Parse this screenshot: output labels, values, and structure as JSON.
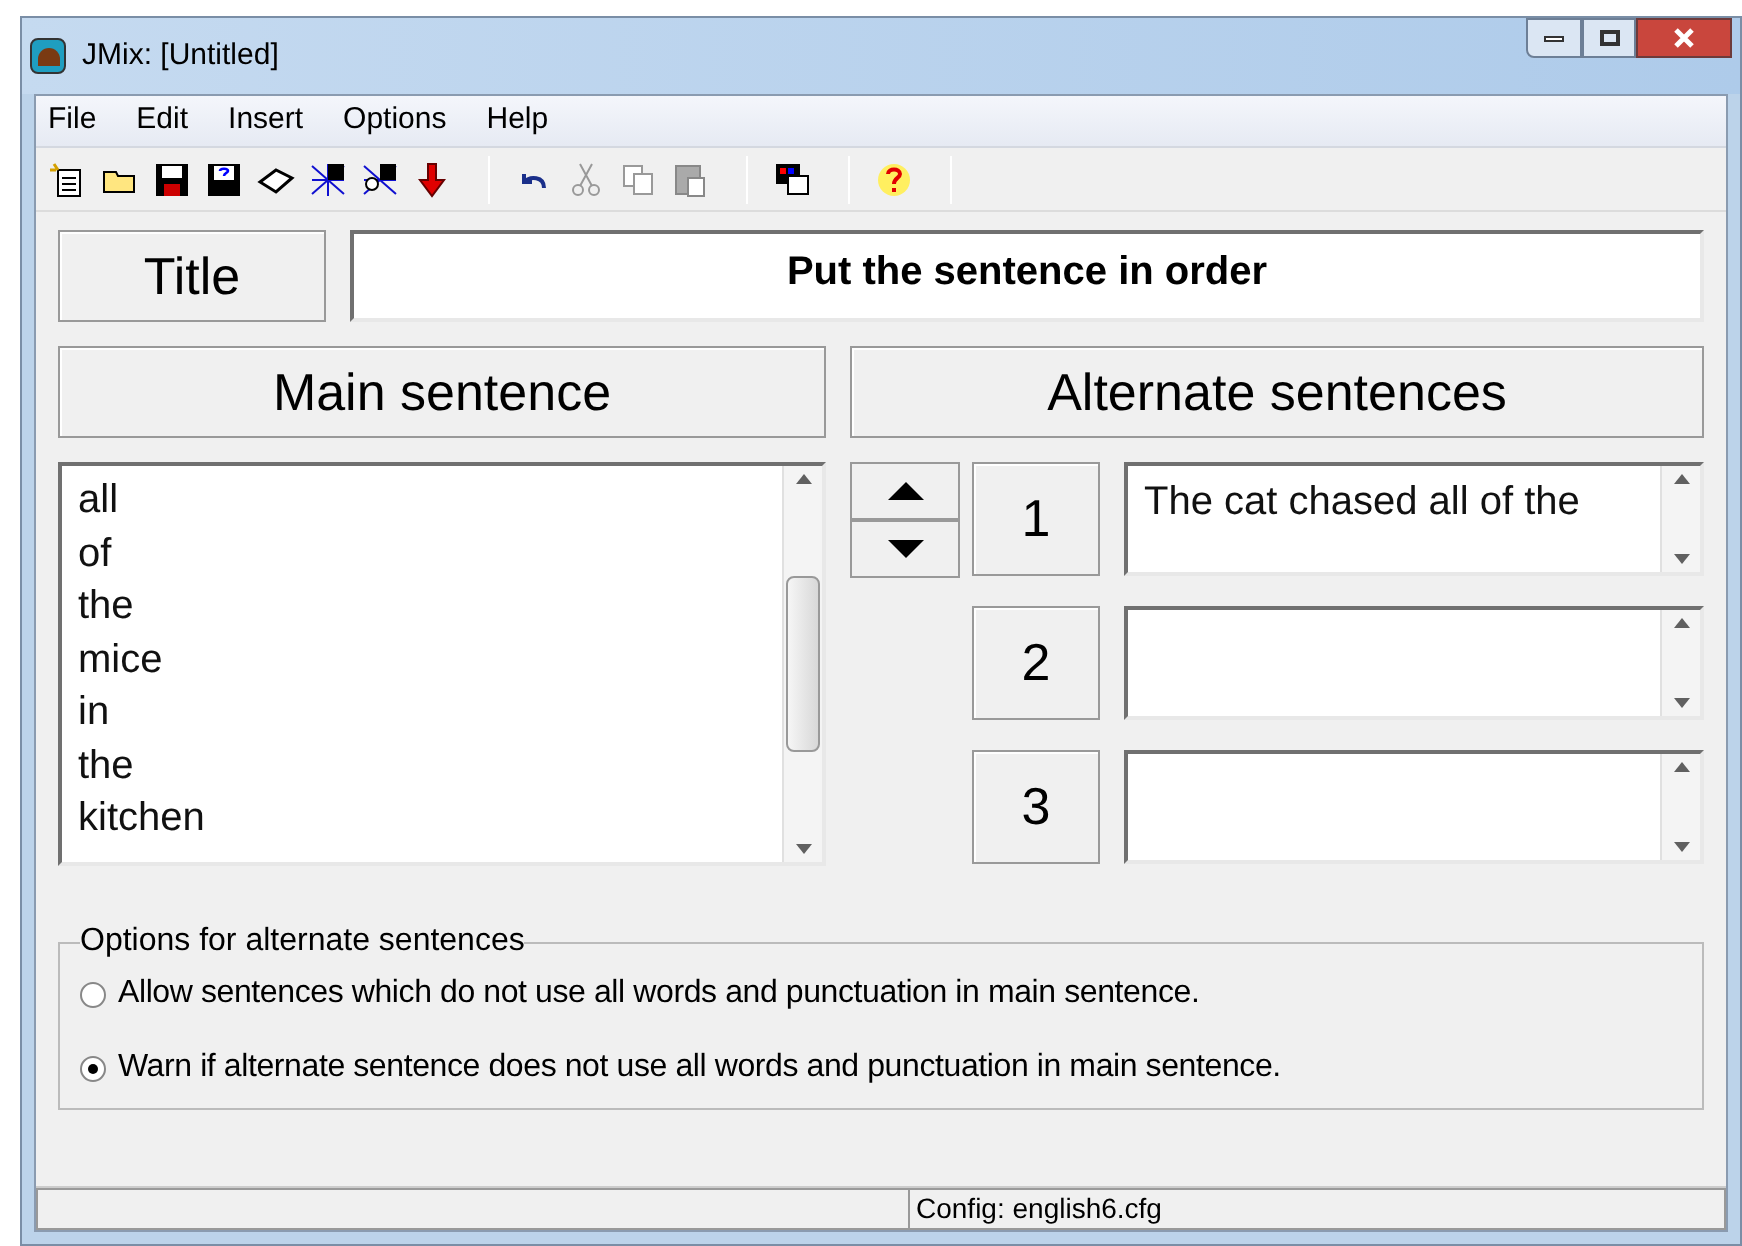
{
  "window": {
    "title": "JMix: [Untitled]"
  },
  "menu": [
    "File",
    "Edit",
    "Insert",
    "Options",
    "Help"
  ],
  "title_field": {
    "label": "Title",
    "value": "Put the sentence in order"
  },
  "main_sentence": {
    "heading": "Main sentence",
    "words": [
      "all",
      "of",
      "the",
      "mice",
      "in",
      "the",
      "kitchen"
    ]
  },
  "alternate_sentences": {
    "heading": "Alternate sentences",
    "rows": [
      {
        "number": "1",
        "value": "The cat chased all of the"
      },
      {
        "number": "2",
        "value": ""
      },
      {
        "number": "3",
        "value": ""
      }
    ]
  },
  "options": {
    "legend": "Options for alternate sentences",
    "items": [
      {
        "label": "Allow sentences which do not use all words and punctuation in main sentence.",
        "selected": false
      },
      {
        "label": "Warn if alternate sentence does not use all words and punctuation in main sentence.",
        "selected": true
      }
    ]
  },
  "status_bar": {
    "config": "Config: english6.cfg"
  }
}
